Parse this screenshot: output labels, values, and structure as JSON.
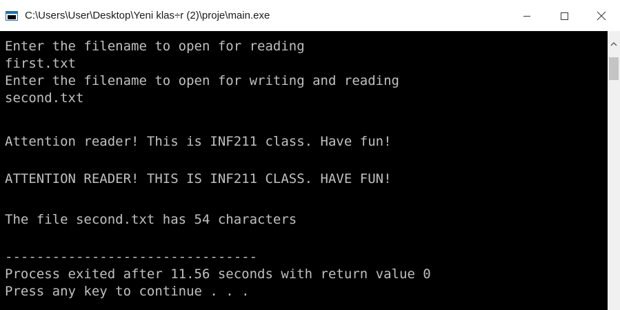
{
  "window": {
    "title": "C:\\Users\\User\\Desktop\\Yeni klas÷r (2)\\proje\\main.exe",
    "icon": "console-app-icon",
    "controls": {
      "minimize_icon": "minimize-icon",
      "maximize_icon": "maximize-icon",
      "close_icon": "close-icon"
    }
  },
  "console": {
    "lines": [
      "Enter the filename to open for reading",
      "first.txt",
      "Enter the filename to open for writing and reading",
      "second.txt",
      "",
      "Attention reader! This is INF211 class. Have fun!",
      "",
      "ATTENTION READER! THIS IS INF211 CLASS. HAVE FUN!",
      "",
      "The file second.txt has 54 characters",
      "",
      "--------------------------------",
      "Process exited after 11.56 seconds with return value 0",
      "Press any key to continue . . ."
    ]
  },
  "scrollbar": {
    "up_icon": "scroll-up-arrow-icon"
  },
  "colors": {
    "console_background": "#000000",
    "console_text": "#c0c0c0",
    "titlebar_background": "#ffffff",
    "scrollbar_track": "#f0f0f0",
    "scrollbar_thumb": "#c4c4c4"
  }
}
